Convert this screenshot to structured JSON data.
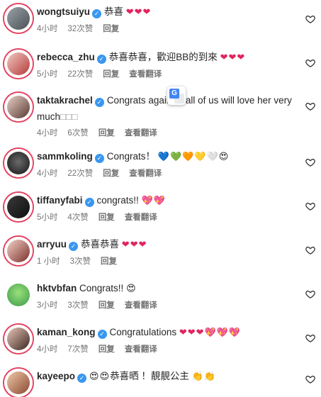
{
  "comments": [
    {
      "user": "wongtsuiyu",
      "verified": true,
      "text": "恭喜",
      "emoji": "❤❤❤",
      "time": "4小时",
      "likes": "32次赞",
      "reply": "回复",
      "translate": ""
    },
    {
      "user": "rebecca_zhu",
      "verified": true,
      "text": "恭喜恭喜，歡迎BB的到來",
      "emoji": "❤❤❤",
      "time": "5小时",
      "likes": "22次赞",
      "reply": "回复",
      "translate": "查看翻译"
    },
    {
      "user": "taktakrachel",
      "verified": true,
      "text": "Congrats again",
      "emoji": "",
      "text2": "all of us will love her very",
      "text3": "much",
      "time": "4小时",
      "likes": "6次赞",
      "reply": "回复",
      "translate": "查看翻译"
    },
    {
      "user": "sammkoling",
      "verified": true,
      "text": "Congrats！",
      "emoji": "💙💚🧡💛🤍😍",
      "time": "4小时",
      "likes": "22次赞",
      "reply": "回复",
      "translate": "查看翻译"
    },
    {
      "user": "tiffanyfabi",
      "verified": true,
      "text": "congrats!!",
      "emoji": "💖💖",
      "time": "5小时",
      "likes": "4次赞",
      "reply": "回复",
      "translate": "查看翻译"
    },
    {
      "user": "arryuu",
      "verified": true,
      "text": "恭喜恭喜",
      "emoji": "❤❤❤",
      "time": "1 小时",
      "likes": "3次赞",
      "reply": "回复",
      "translate": ""
    },
    {
      "user": "hktvbfan",
      "verified": false,
      "text": "Congrats!!",
      "emoji": "😍",
      "time": "3小时",
      "likes": "3次赞",
      "reply": "回复",
      "translate": "查看翻译"
    },
    {
      "user": "kaman_kong",
      "verified": true,
      "text": "Congratulations",
      "emoji": "❤❤❤💖💖💖",
      "time": "4小时",
      "likes": "7次赞",
      "reply": "回复",
      "translate": "查看翻译"
    },
    {
      "user": "kayeepo",
      "verified": true,
      "text": "恭喜晒 ！靚靚公主",
      "emoji": "😍😍",
      "emoji2": "👏👏",
      "time": "",
      "likes": "",
      "reply": "",
      "translate": ""
    }
  ],
  "colors": {
    "heart_red": "#e0245e",
    "verified_blue": "#3897f0",
    "meta_gray": "#737373"
  },
  "icons": {
    "like": "heart-outline-icon",
    "verified": "verified-badge-icon",
    "translate": "google-translate-icon"
  }
}
